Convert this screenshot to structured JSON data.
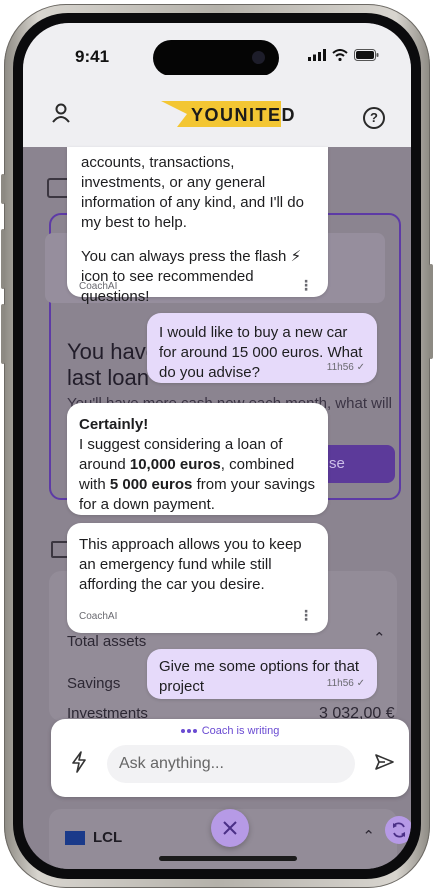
{
  "status_bar": {
    "time": "9:41"
  },
  "header": {
    "brand": "YOUNITED",
    "help_symbol": "?"
  },
  "background": {
    "promo_title_line1": "You have f",
    "promo_title_line2": "last loan",
    "promo_subtitle": "You'll have more cash now each month, what will be",
    "promo_button": "se",
    "assets_title": "Total assets",
    "savings_label": "Savings",
    "investments_label": "Investments",
    "investments_value": "3 032,00 €",
    "bank_name": "LCL",
    "bank_logo": "LCL"
  },
  "chat": {
    "bot_message_1": {
      "text_1": "accounts, transactions, investments, or any general information of any kind, and I'll do my best to help.",
      "text_2": "You can always press the flash ⚡ icon to see recommended questions!",
      "sender": "CoachAI"
    },
    "user_message_1": {
      "text": "I would like to buy a new car for around 15 000 euros. What do you advise?",
      "time": "11h56"
    },
    "bot_message_2": {
      "heading": "Certainly!",
      "p1": "I suggest considering a loan of around ",
      "b1": "10,000 euros",
      "p2": ", combined with ",
      "b2": "5 000 euros",
      "p3": " from your savings for a down payment."
    },
    "bot_message_3": {
      "text": "This approach allows you to keep an emergency fund while still affording the car you desire.",
      "sender": "CoachAI"
    },
    "user_message_2": {
      "text": "Give me some options for that project",
      "time": "11h56"
    }
  },
  "composer": {
    "status": "Coach is writing",
    "placeholder": "Ask anything..."
  },
  "colors": {
    "accent": "#6a4bd2",
    "user_bubble": "#e6dafa",
    "overlay": "#8b8490",
    "brand_yellow": "#f3c633"
  }
}
